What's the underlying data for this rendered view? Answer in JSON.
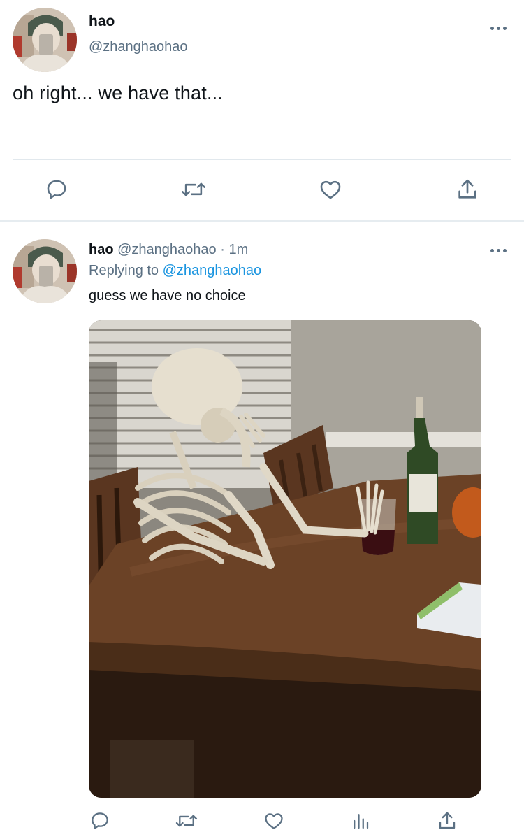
{
  "main_tweet": {
    "display_name": "hao",
    "handle": "@zhanghaohao",
    "text": "oh right... we have that...",
    "actions": [
      "reply-icon",
      "retweet-icon",
      "like-icon",
      "share-icon"
    ]
  },
  "reply_tweet": {
    "display_name": "hao",
    "handle": "@zhanghaohao",
    "separator": "·",
    "time": "1m",
    "replying_prefix": "Replying to",
    "replying_to": "@zhanghaohao",
    "text": "guess we have no choice",
    "media_description": "skeleton-at-table-photo",
    "actions": [
      "reply-icon",
      "retweet-icon",
      "like-icon",
      "analytics-icon",
      "share-icon"
    ]
  },
  "colors": {
    "text_primary": "#0f1419",
    "text_secondary": "#5b7083",
    "link": "#1b95e0",
    "divider": "#e1e8ed"
  }
}
